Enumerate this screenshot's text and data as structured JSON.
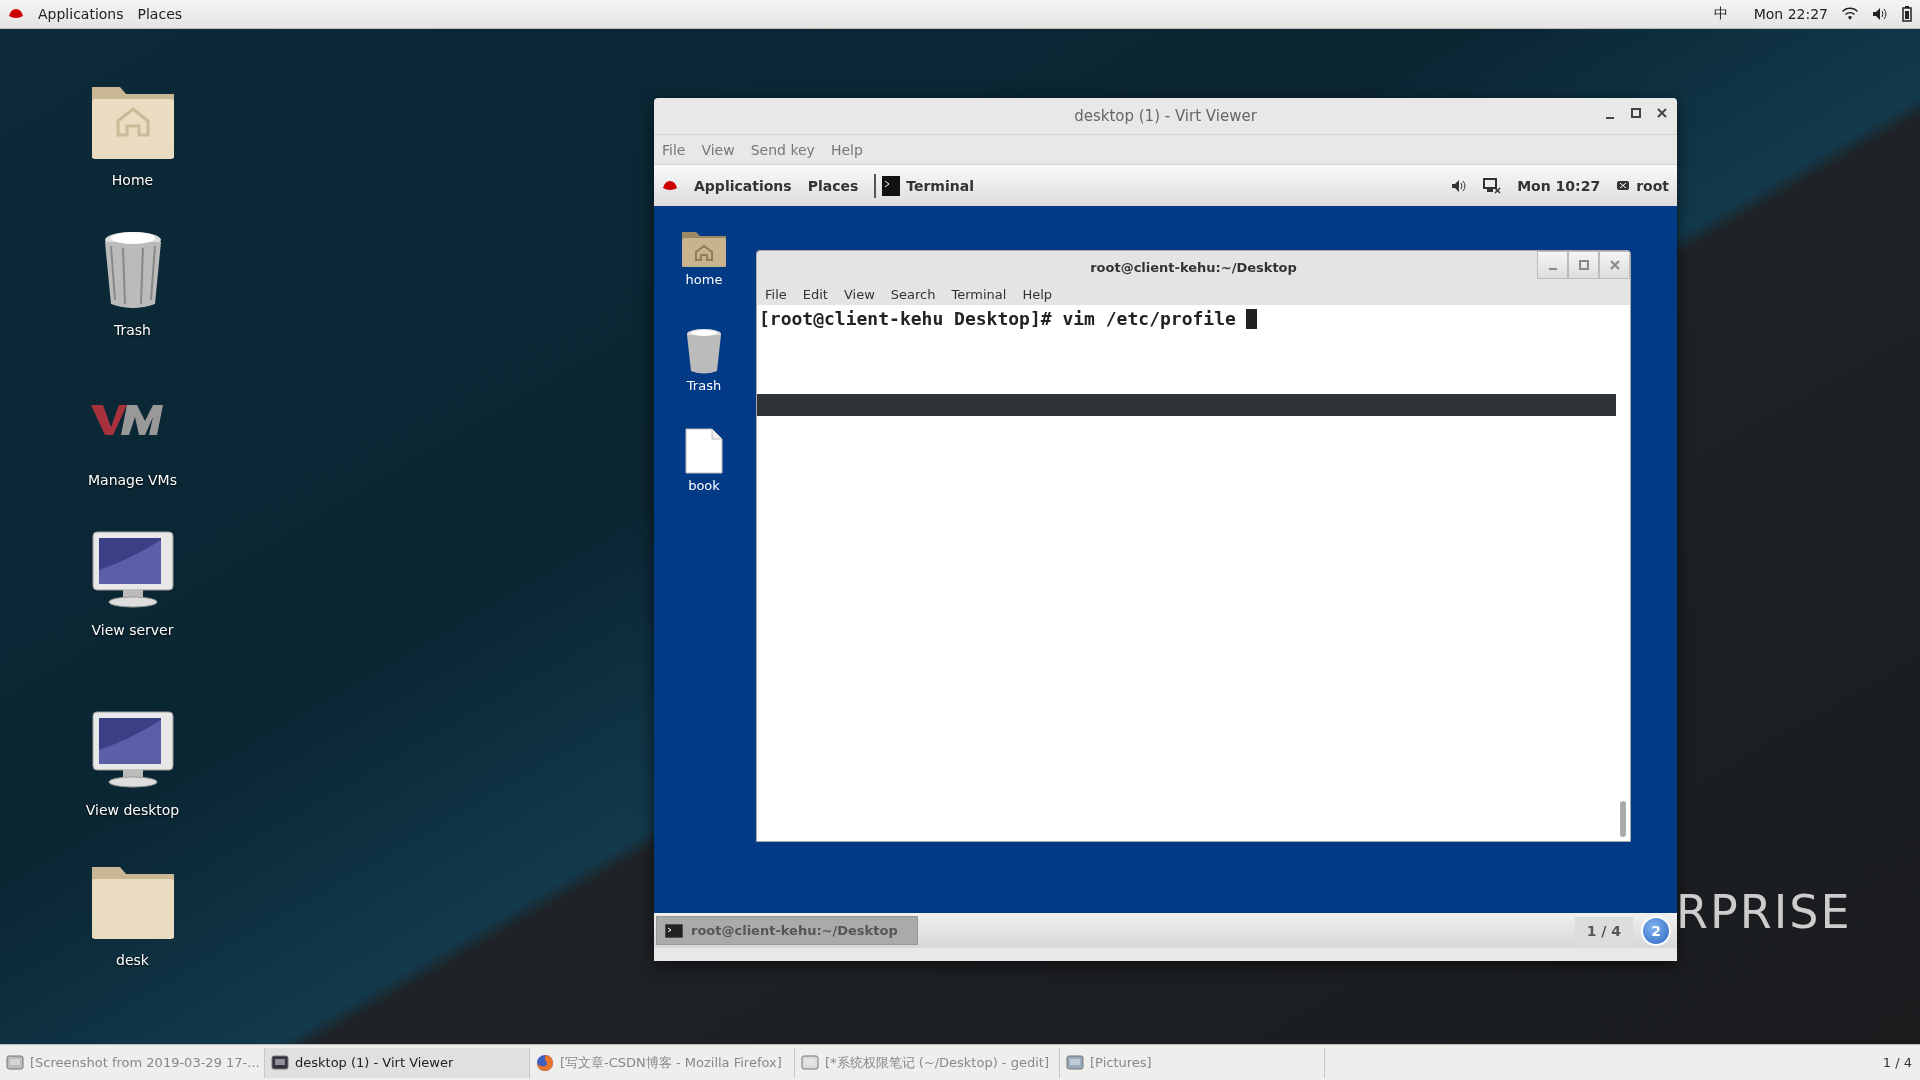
{
  "top_bar": {
    "menus": [
      "Applications",
      "Places"
    ],
    "input_method": "中",
    "clock": "Mon 22:27"
  },
  "desktop_icons": [
    {
      "kind": "home",
      "label": "Home"
    },
    {
      "kind": "trash",
      "label": "Trash"
    },
    {
      "kind": "vm",
      "label": "Manage VMs"
    },
    {
      "kind": "monitor",
      "label": "View server"
    },
    {
      "kind": "monitor",
      "label": "View desktop"
    },
    {
      "kind": "folder",
      "label": "desk"
    }
  ],
  "wallpaper_text": "RPRISE",
  "viewer": {
    "title": "desktop (1) - Virt Viewer",
    "menu": [
      "File",
      "View",
      "Send key",
      "Help"
    ],
    "guest": {
      "top_bar": {
        "menus": [
          "Applications",
          "Places"
        ],
        "app": "Terminal",
        "clock": "Mon 10:27",
        "user": "root"
      },
      "icons": [
        {
          "kind": "home",
          "label": "home"
        },
        {
          "kind": "trash",
          "label": "Trash"
        },
        {
          "kind": "file",
          "label": "book"
        }
      ],
      "terminal": {
        "title": "root@client-kehu:~/Desktop",
        "menu": [
          "File",
          "Edit",
          "View",
          "Search",
          "Terminal",
          "Help"
        ],
        "prompt": "[root@client-kehu Desktop]# vim /etc/profile"
      },
      "taskbar": {
        "items": [
          {
            "label": "root@client-kehu:~/Desktop",
            "selected": true
          }
        ],
        "workspace": "1 / 4",
        "notifications": "2"
      }
    }
  },
  "taskbar": [
    {
      "kind": "screenshot",
      "label": "[Screenshot from 2019-03-29 17-...",
      "selected": false
    },
    {
      "kind": "viewer",
      "label": "desktop (1) - Virt Viewer",
      "selected": true
    },
    {
      "kind": "firefox",
      "label": "[写文章-CSDN博客 - Mozilla Firefox]",
      "selected": false
    },
    {
      "kind": "gedit",
      "label": "[*系统权限笔记 (~/Desktop) - gedit]",
      "selected": false
    },
    {
      "kind": "files",
      "label": "[Pictures]",
      "selected": false
    }
  ],
  "workspace": "1 / 4"
}
